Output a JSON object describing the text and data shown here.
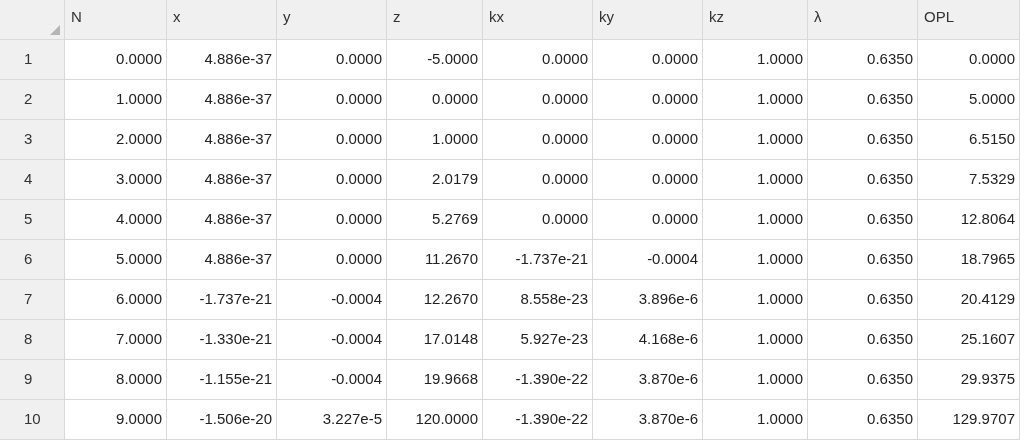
{
  "table": {
    "columns": [
      "N",
      "x",
      "y",
      "z",
      "kx",
      "ky",
      "kz",
      "λ",
      "OPL"
    ],
    "rows": [
      {
        "header": "1",
        "cells": [
          "0.0000",
          "4.886e-37",
          "0.0000",
          "-5.0000",
          "0.0000",
          "0.0000",
          "1.0000",
          "0.6350",
          "0.0000"
        ]
      },
      {
        "header": "2",
        "cells": [
          "1.0000",
          "4.886e-37",
          "0.0000",
          "0.0000",
          "0.0000",
          "0.0000",
          "1.0000",
          "0.6350",
          "5.0000"
        ]
      },
      {
        "header": "3",
        "cells": [
          "2.0000",
          "4.886e-37",
          "0.0000",
          "1.0000",
          "0.0000",
          "0.0000",
          "1.0000",
          "0.6350",
          "6.5150"
        ]
      },
      {
        "header": "4",
        "cells": [
          "3.0000",
          "4.886e-37",
          "0.0000",
          "2.0179",
          "0.0000",
          "0.0000",
          "1.0000",
          "0.6350",
          "7.5329"
        ]
      },
      {
        "header": "5",
        "cells": [
          "4.0000",
          "4.886e-37",
          "0.0000",
          "5.2769",
          "0.0000",
          "0.0000",
          "1.0000",
          "0.6350",
          "12.8064"
        ]
      },
      {
        "header": "6",
        "cells": [
          "5.0000",
          "4.886e-37",
          "0.0000",
          "11.2670",
          "-1.737e-21",
          "-0.0004",
          "1.0000",
          "0.6350",
          "18.7965"
        ]
      },
      {
        "header": "7",
        "cells": [
          "6.0000",
          "-1.737e-21",
          "-0.0004",
          "12.2670",
          "8.558e-23",
          "3.896e-6",
          "1.0000",
          "0.6350",
          "20.4129"
        ]
      },
      {
        "header": "8",
        "cells": [
          "7.0000",
          "-1.330e-21",
          "-0.0004",
          "17.0148",
          "5.927e-23",
          "4.168e-6",
          "1.0000",
          "0.6350",
          "25.1607"
        ]
      },
      {
        "header": "9",
        "cells": [
          "8.0000",
          "-1.155e-21",
          "-0.0004",
          "19.9668",
          "-1.390e-22",
          "3.870e-6",
          "1.0000",
          "0.6350",
          "29.9375"
        ]
      },
      {
        "header": "10",
        "cells": [
          "9.0000",
          "-1.506e-20",
          "3.227e-5",
          "120.0000",
          "-1.390e-22",
          "3.870e-6",
          "1.0000",
          "0.6350",
          "129.9707"
        ]
      }
    ]
  }
}
